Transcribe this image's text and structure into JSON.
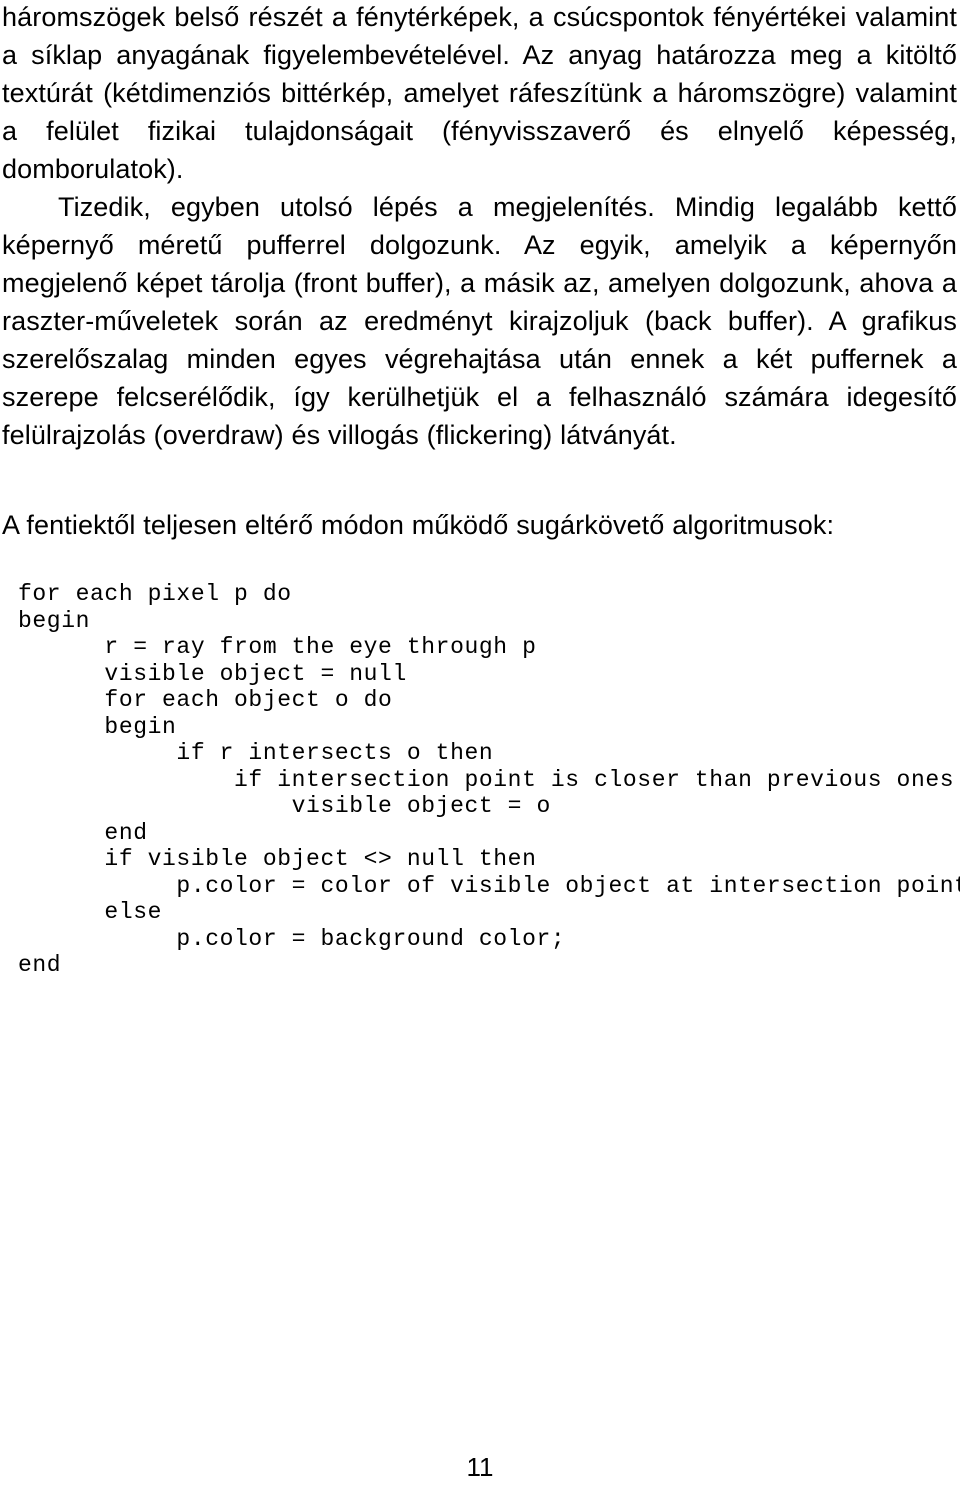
{
  "document": {
    "language": "hu",
    "page_number": "11",
    "body": {
      "paragraph_1": "háromszögek belső részét a fénytérképek, a csúcspontok fényértékei valamint a síklap anyagának figyelembevételével. Az anyag határozza meg a kitöltő textúrát (kétdimenziós bittérkép, amelyet ráfeszítünk a háromszögre) valamint a felület fizikai tulajdonságait (fényvisszaverő és elnyelő képesség, domborulatok).",
      "paragraph_2": "Tizedik, egyben utolsó lépés a megjelenítés. Mindig legalább kettő képernyő méretű pufferrel dolgozunk. Az egyik, amelyik a képernyőn megjelenő képet tárolja (front buffer), a másik az, amelyen dolgozunk, ahova a raszter-műveletek során az eredményt kirajzoljuk (back buffer). A grafikus szerelőszalag minden egyes végrehajtása után ennek a két puffernek a szerepe felcserélődik, így kerülhetjük el a felhasználó számára idegesítő felülrajzolás (overdraw) és villogás (flickering) látványát.",
      "paragraph_3": "A fentiektől teljesen eltérő módon működő sugárkövető algoritmusok:"
    },
    "code_listing": {
      "language": "pseudocode",
      "lines": [
        "for each pixel p do",
        "begin",
        "      r = ray from the eye through p",
        "      visible object = null",
        "      for each object o do",
        "      begin",
        "           if r intersects o then",
        "               if intersection point is closer than previous ones then",
        "                   visible object = o",
        "      end",
        "      if visible object <> null then",
        "           p.color = color of visible object at intersection point",
        "      else",
        "           p.color = background color;",
        "end"
      ]
    }
  }
}
